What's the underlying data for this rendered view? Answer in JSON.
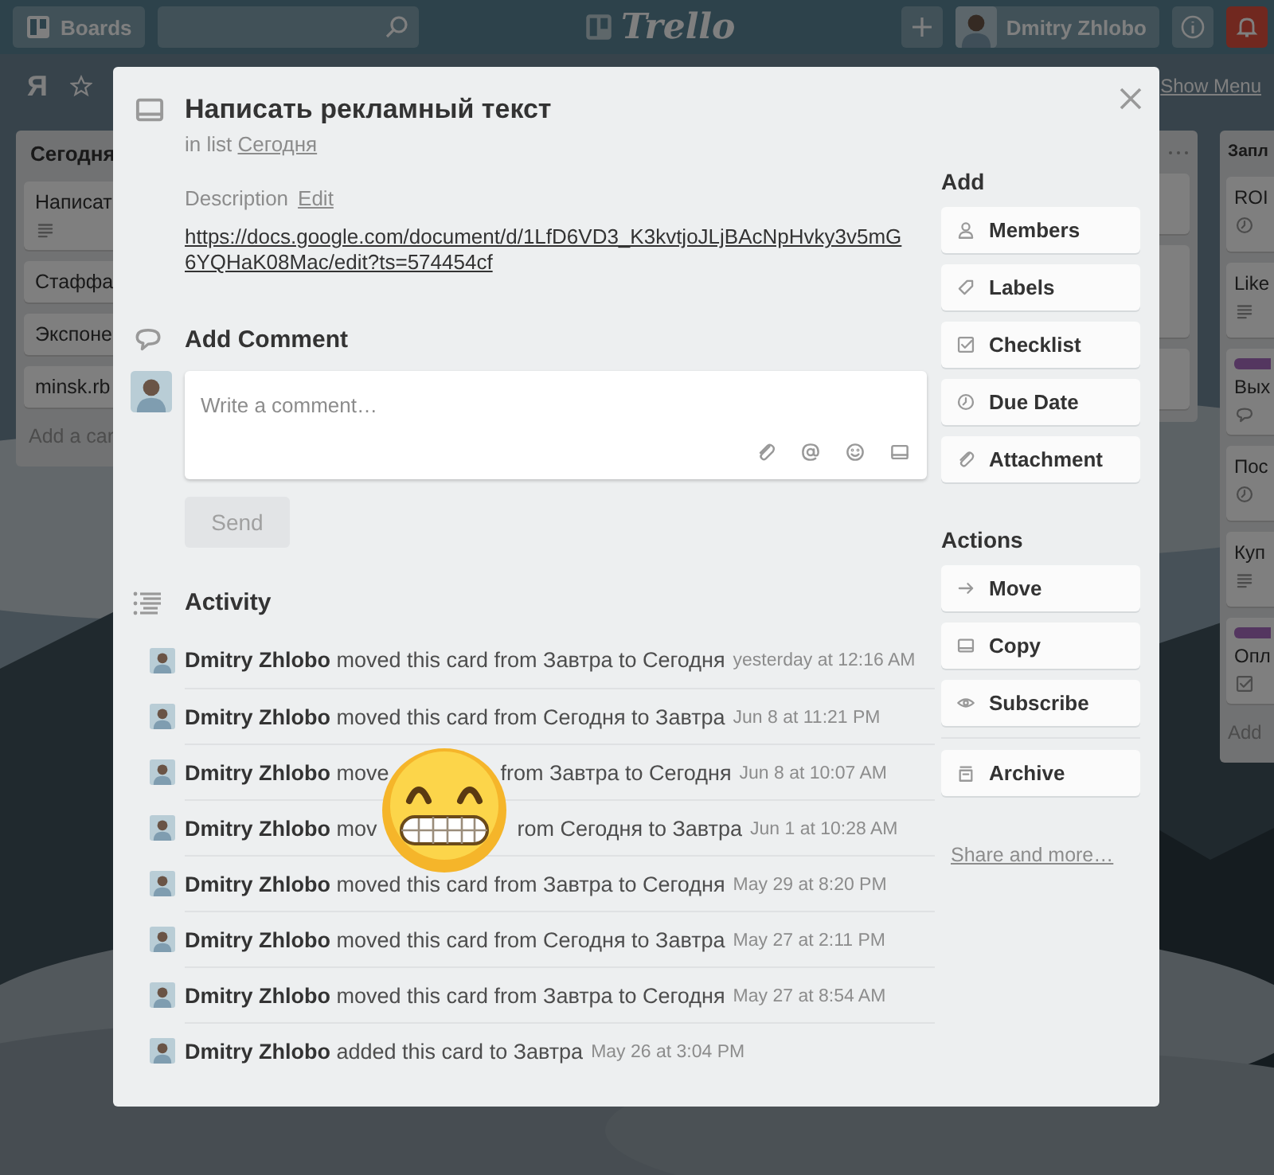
{
  "header": {
    "boards_button": "Boards",
    "logo": "Trello",
    "user_name": "Dmitry Zhlobo"
  },
  "board": {
    "title": "Я",
    "show_menu": "Show Menu",
    "lists": [
      {
        "title": "Сегодня",
        "cards": [
          {
            "title": "Написат",
            "kind": "description"
          },
          {
            "title": "Стаффа"
          },
          {
            "title": "Экспоне"
          },
          {
            "title": "minsk.rb"
          }
        ],
        "add_card": "Add a car"
      },
      {
        "title": "Запл",
        "cards": [
          {
            "title": "ROI",
            "kind": "clock",
            "labeled": false
          },
          {
            "title": "Like",
            "kind": "description",
            "labeled": false
          },
          {
            "title": "Вых",
            "kind": "comment",
            "labeled": true
          },
          {
            "title": "Пос",
            "kind": "clock",
            "labeled": false
          },
          {
            "title": "Куп",
            "kind": "description",
            "labeled": false
          },
          {
            "title": "Опл",
            "kind": "checklist",
            "labeled": true
          }
        ],
        "add_card": "Add"
      }
    ]
  },
  "card": {
    "title": "Написать рекламный текст",
    "list_prefix": "in list",
    "list_name": "Сегодня",
    "description_label": "Description",
    "edit_link": "Edit",
    "description": "https://docs.google.com/document/d/1LfD6VD3_K3kvtjoJLjBAcNpHvky3v5mG6YQHaK08Mac/edit?ts=574454cf"
  },
  "comment": {
    "heading": "Add Comment",
    "placeholder": "Write a comment…",
    "send": {
      "label": "Send",
      "disabled": true
    }
  },
  "activity": {
    "heading": "Activity",
    "items": [
      {
        "text": "**Dmitry Zhlobo** moved this card from Завтра to Сегодня",
        "time": "yesterday at 12:16 AM"
      },
      {
        "text": "**Dmitry Zhlobo** moved this card from Сегодня to Завтра",
        "time": "Jun 8 at 11:21 PM"
      },
      {
        "text": "**Dmitry Zhlobo** move",
        "text_after": "from Завтра to Сегодня",
        "time": "Jun 8 at 10:07 AM"
      },
      {
        "text": "**Dmitry Zhlobo** mov",
        "text_after": "rom Сегодня to Завтра",
        "time": "Jun 1 at 10:28 AM"
      },
      {
        "text": "**Dmitry Zhlobo** moved this card from Завтра to Сегодня",
        "time": "May 29 at 8:20 PM"
      },
      {
        "text": "**Dmitry Zhlobo** moved this card from Сегодня to Завтра",
        "time": "May 27 at 2:11 PM"
      },
      {
        "text": "**Dmitry Zhlobo** moved this card from Завтра to Сегодня",
        "time": "May 27 at 8:54 AM"
      },
      {
        "text": "**Dmitry Zhlobo** added this card to Завтра",
        "time": "May 26 at 3:04 PM"
      }
    ]
  },
  "sidebar": {
    "add_heading": "Add",
    "add_buttons": [
      {
        "label": "Members",
        "kind": "person",
        "divider_before": false
      },
      {
        "label": "Labels",
        "kind": "tag",
        "divider_before": false
      },
      {
        "label": "Checklist",
        "kind": "checkbox",
        "divider_before": false
      },
      {
        "label": "Due Date",
        "kind": "clock",
        "divider_before": false
      },
      {
        "label": "Attachment",
        "kind": "paperclip",
        "divider_before": false
      }
    ],
    "actions_heading": "Actions",
    "action_buttons": [
      {
        "label": "Move",
        "kind": "arrow",
        "divider_before": false
      },
      {
        "label": "Copy",
        "kind": "card",
        "divider_before": false
      },
      {
        "label": "Subscribe",
        "kind": "eye",
        "divider_before": false
      },
      {
        "label": "Archive",
        "kind": "archive",
        "divider_before": true
      }
    ],
    "share_link": "Share and more…"
  }
}
